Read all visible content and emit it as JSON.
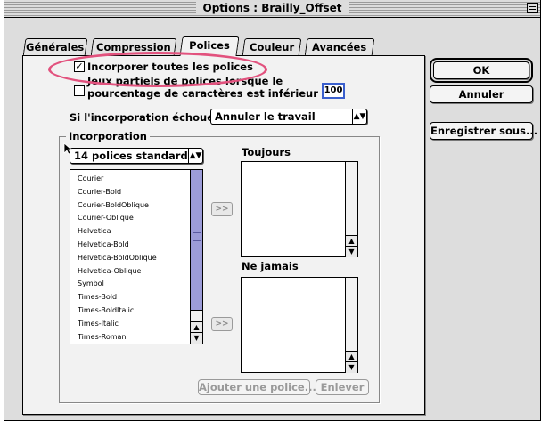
{
  "window": {
    "title": "Options : Brailly_Offset"
  },
  "tabs": [
    {
      "label": "Générales"
    },
    {
      "label": "Compression"
    },
    {
      "label": "Polices"
    },
    {
      "label": "Couleur"
    },
    {
      "label": "Avancées"
    }
  ],
  "active_tab": "Polices",
  "options": {
    "embed_all_label": "Incorporer toutes les polices",
    "embed_all_checked": true,
    "subset_line1": "Jeux partiels de polices lorsque le",
    "subset_line2": "pourcentage de caractères est inférieur à :",
    "subset_checked": false,
    "subset_value": "100",
    "fail_label": "Si l'incorporation échoue :",
    "fail_value": "Annuler le travail"
  },
  "incorporation": {
    "group_title": "Incorporation",
    "source_value": "14 polices standard",
    "fonts": [
      "Courier",
      "Courier-Bold",
      "Courier-BoldOblique",
      "Courier-Oblique",
      "Helvetica",
      "Helvetica-Bold",
      "Helvetica-BoldOblique",
      "Helvetica-Oblique",
      "Symbol",
      "Times-Bold",
      "Times-BoldItalic",
      "Times-Italic",
      "Times-Roman"
    ],
    "always_label": "Toujours",
    "never_label": "Ne jamais",
    "move_label": ">>",
    "add_font_label": "Ajouter une police...",
    "remove_label": "Enlever"
  },
  "buttons": {
    "ok": "OK",
    "cancel": "Annuler",
    "save_as": "Enregistrer sous..."
  },
  "colors": {
    "highlight": "#e2527e",
    "scroll_thumb": "#9c9cd8",
    "field_focus": "#3a5fcd"
  }
}
